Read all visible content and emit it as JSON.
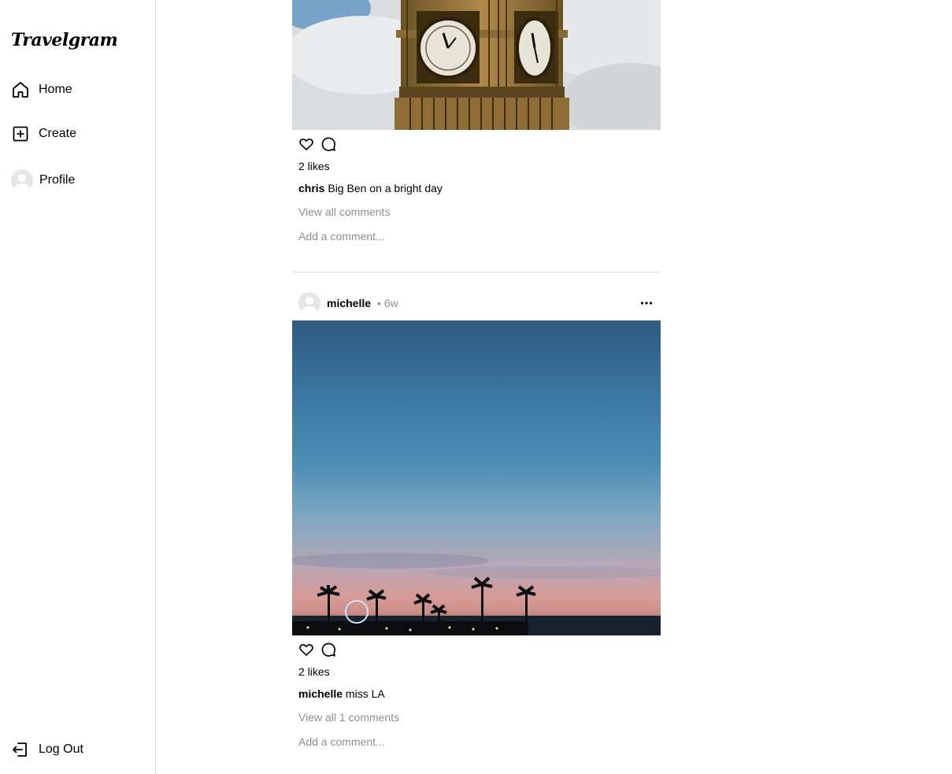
{
  "app": {
    "name": "Travelgram"
  },
  "sidebar": {
    "items": [
      {
        "label": "Home",
        "icon": "home-icon"
      },
      {
        "label": "Create",
        "icon": "plus-square-icon"
      },
      {
        "label": "Profile",
        "icon": "avatar"
      }
    ],
    "logout": {
      "label": "Log Out",
      "icon": "logout-icon"
    }
  },
  "posts": [
    {
      "likes": "2 likes",
      "caption_user": "chris",
      "caption_text": "Big Ben on a bright day",
      "comments_link": "View all comments",
      "comment_placeholder": "Add a comment..."
    },
    {
      "user": "michelle",
      "time": "• 6w",
      "likes": "2 likes",
      "caption_user": "michelle",
      "caption_text": "miss LA",
      "comments_link": "View all 1 comments",
      "comment_placeholder": "Add a comment..."
    }
  ],
  "colors": {
    "border": "#dbdbdb",
    "muted_text": "#8e8e8e"
  }
}
